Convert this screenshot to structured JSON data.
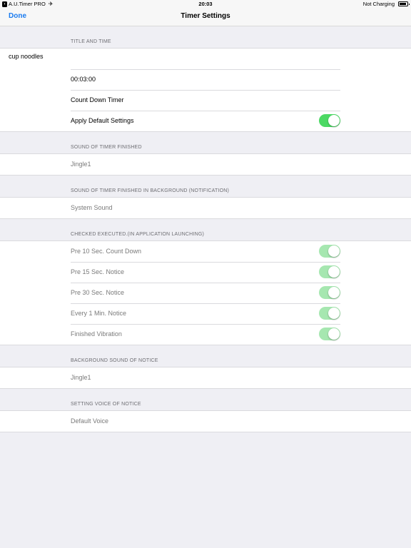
{
  "status_bar": {
    "app_name": "A.U.Timer PRO",
    "time": "20:03",
    "charging": "Not Charging"
  },
  "nav": {
    "done": "Done",
    "title": "Timer Settings"
  },
  "sections": {
    "title_time": {
      "header": "TITLE AND TIME",
      "title_value": "cup noodles",
      "time_value": "00:03:00",
      "mode": "Count Down Timer",
      "apply_default": "Apply Default Settings",
      "apply_default_on": true
    },
    "finished_sound": {
      "header": "SOUND OF TIMER FINISHED",
      "value": "Jingle1"
    },
    "background_sound": {
      "header": "SOUND OF TIMER FINISHED IN BACKGROUND (NOTIFICATION)",
      "value": "System Sound"
    },
    "checked": {
      "header": "CHECKED EXECUTED.(IN APPLICATION LAUNCHING)",
      "items": [
        {
          "label": "Pre 10 Sec. Count Down",
          "on": true
        },
        {
          "label": "Pre 15 Sec. Notice",
          "on": true
        },
        {
          "label": "Pre 30 Sec. Notice",
          "on": true
        },
        {
          "label": "Every 1 Min. Notice",
          "on": true
        },
        {
          "label": "Finished Vibration",
          "on": true
        }
      ]
    },
    "notice_sound": {
      "header": "BACKGROUND SOUND OF NOTICE",
      "value": "Jingle1"
    },
    "voice": {
      "header": "SETTING VOICE OF NOTICE",
      "value": "Default Voice"
    }
  },
  "colors": {
    "accent": "#1a7bf0",
    "toggle_on": "#4cd964",
    "toggle_disabled": "#a6e7b0",
    "background": "#efeff4"
  }
}
